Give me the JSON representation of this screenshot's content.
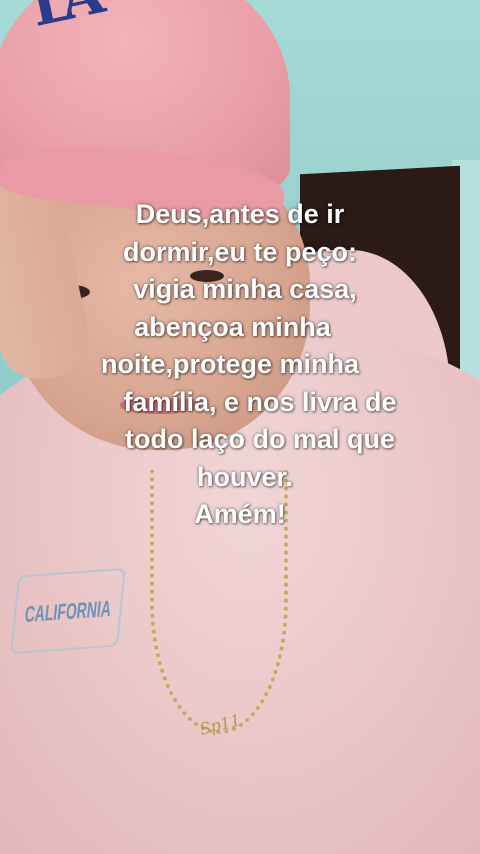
{
  "caption": {
    "lines": [
      "Deus,antes de ir",
      "dormir,eu te peço:",
      "vigia minha casa,",
      "abençoa minha",
      "noite,protege minha",
      "família, e nos livra de",
      "todo laço do mal que",
      "houver.",
      "Amém!"
    ]
  },
  "background": {
    "cap_logo": "LA",
    "badge_text": "CALIFORNIA",
    "pendant_text": "Sp11"
  },
  "colors": {
    "wall": "#a6dad6",
    "cap": "#e99fa8",
    "hoodie": "#e9c3c4",
    "caption_text": "#ffffff"
  }
}
